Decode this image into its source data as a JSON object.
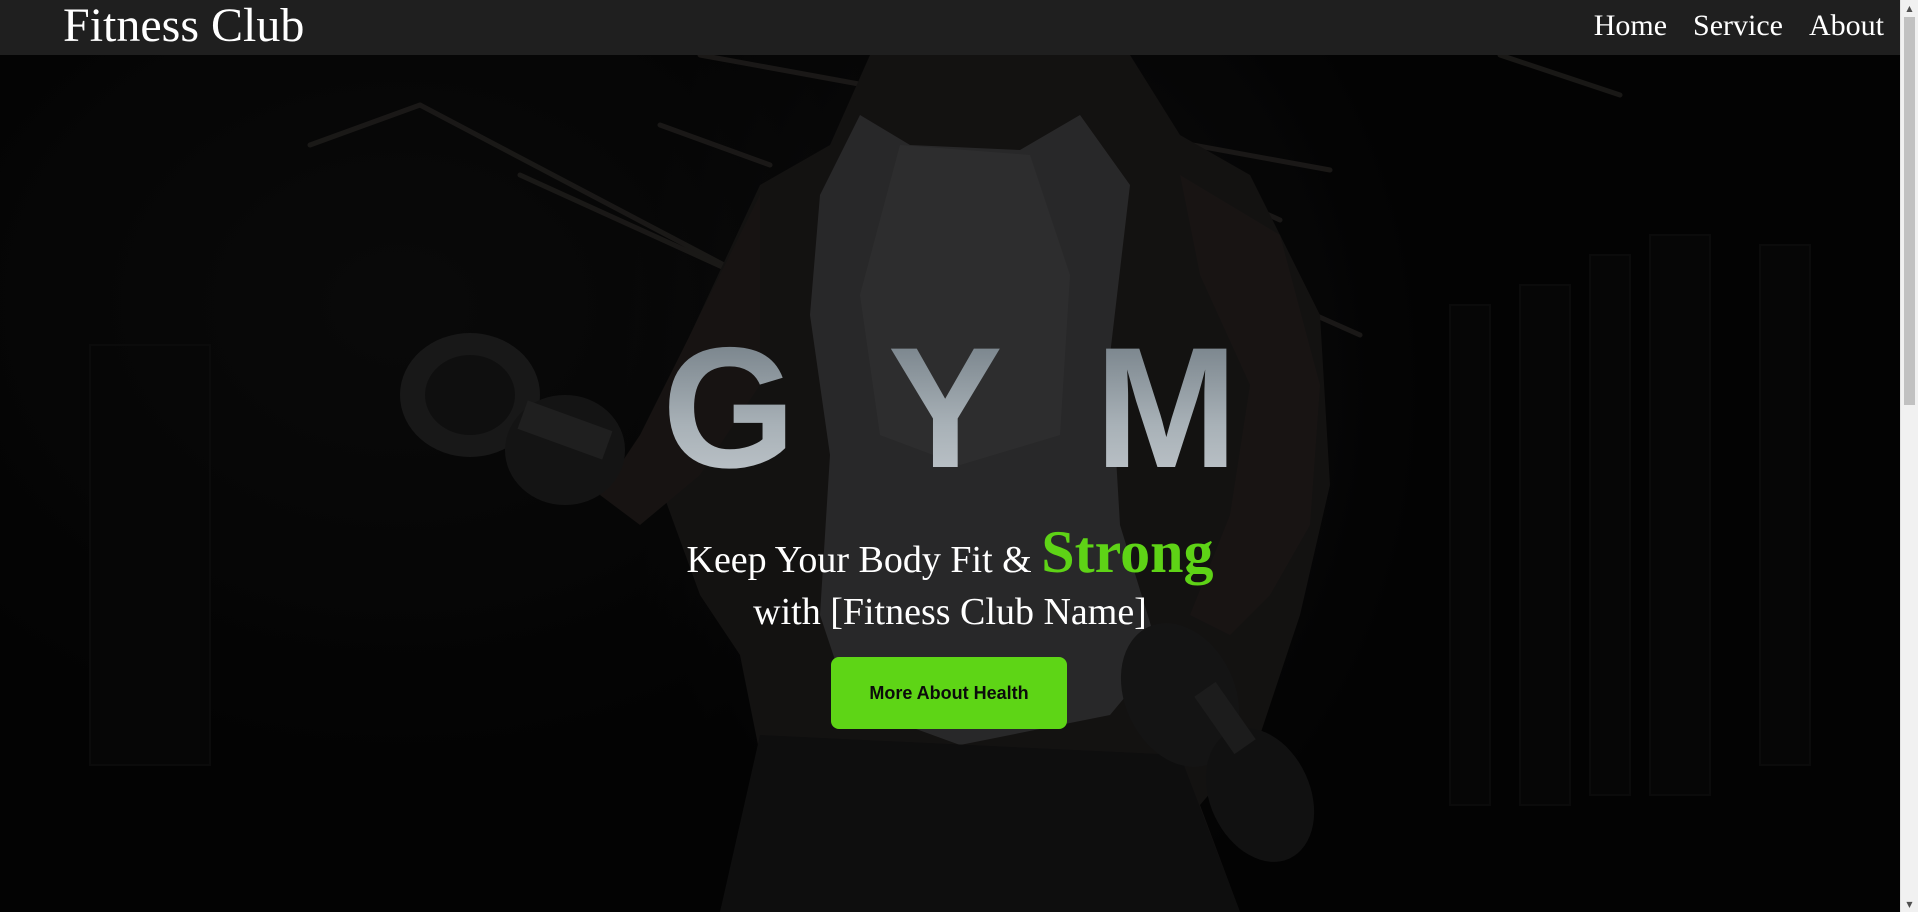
{
  "navbar": {
    "brand": "Fitness Club",
    "links": [
      "Home",
      "Service",
      "About"
    ]
  },
  "hero": {
    "title": "GYM",
    "tagline_line1": "Keep Your Body Fit & ",
    "tagline_highlight": "Strong",
    "tagline_line2": "with [Fitness Club Name]",
    "cta_label": "More About Health"
  },
  "colors": {
    "accent": "#5ed516",
    "navbar_bg": "#1f1f1f",
    "title_gray": "#a8b1b7"
  },
  "icons": {
    "scroll_up": "scroll-up-arrow-icon",
    "scroll_down": "scroll-down-arrow-icon"
  }
}
